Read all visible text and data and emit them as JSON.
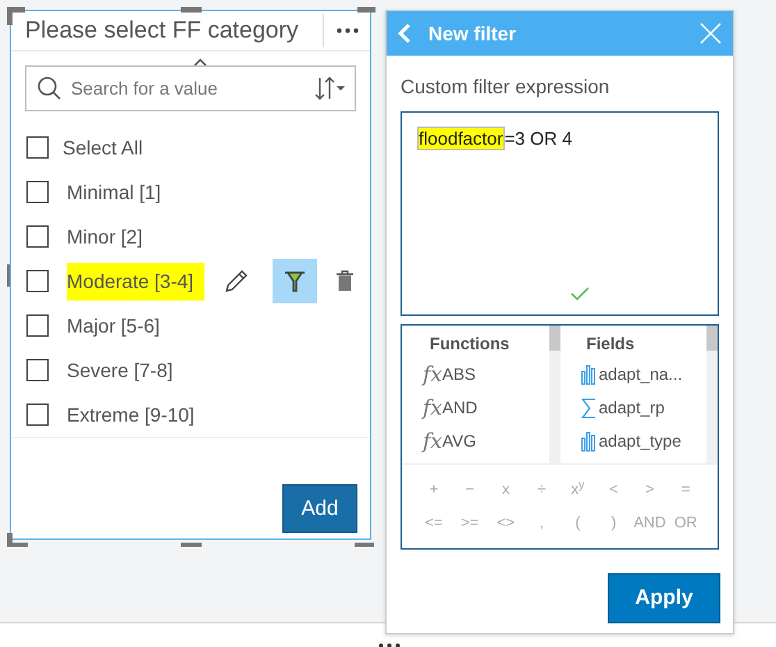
{
  "category_panel": {
    "title": "Please select FF category",
    "search": {
      "placeholder": "Search for a value"
    },
    "select_all": {
      "label": "Select All",
      "checked": false
    },
    "items": [
      {
        "label": "Minimal [1]",
        "checked": false,
        "highlighted": false,
        "hovered": false
      },
      {
        "label": "Minor [2]",
        "checked": false,
        "highlighted": false,
        "hovered": false
      },
      {
        "label": "Moderate [3-4]",
        "checked": false,
        "highlighted": true,
        "hovered": true
      },
      {
        "label": "Major [5-6]",
        "checked": false,
        "highlighted": false,
        "hovered": false
      },
      {
        "label": "Severe [7-8]",
        "checked": false,
        "highlighted": false,
        "hovered": false
      },
      {
        "label": "Extreme [9-10]",
        "checked": false,
        "highlighted": false,
        "hovered": false
      }
    ],
    "add_button": "Add"
  },
  "filter_panel": {
    "title": "New filter",
    "expression_label": "Custom filter expression",
    "expression": {
      "field": "floodfactor",
      "rest": "=3 OR 4",
      "field_highlighted": true,
      "valid": true
    },
    "functions": {
      "heading": "Functions",
      "items": [
        {
          "prefix": "fx",
          "name": "ABS"
        },
        {
          "prefix": "fx",
          "name": "AND"
        },
        {
          "prefix": "fx",
          "name": "AVG"
        }
      ]
    },
    "fields": {
      "heading": "Fields",
      "items": [
        {
          "kind": "string",
          "name": "adapt_na..."
        },
        {
          "kind": "number",
          "name": "adapt_rp"
        },
        {
          "kind": "string",
          "name": "adapt_type"
        }
      ]
    },
    "operators": [
      [
        "+",
        "−",
        "x",
        "÷",
        "x$^{y}$",
        "<",
        ">",
        "="
      ],
      [
        "<=",
        ">=",
        "<>",
        ",",
        "(",
        ")",
        "AND",
        "OR"
      ]
    ],
    "apply_button": "Apply"
  }
}
